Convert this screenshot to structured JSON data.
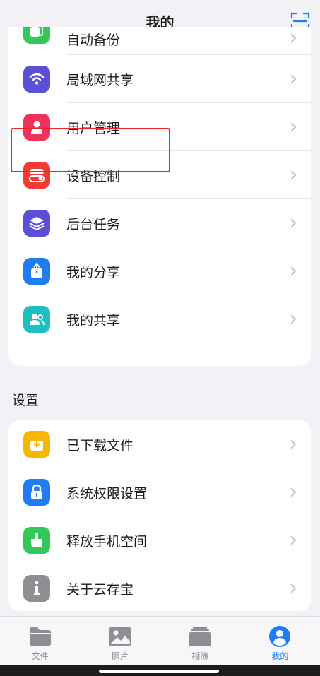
{
  "header": {
    "title": "我的"
  },
  "colors": {
    "accent": "#1e7df2",
    "highlight": "#e8262a"
  },
  "main_list": [
    {
      "label": "自动备份",
      "icon": "backup-icon",
      "color": "#34c759"
    },
    {
      "label": "局域网共享",
      "icon": "wifi-icon",
      "color": "#5b4fd6"
    },
    {
      "label": "用户管理",
      "icon": "user-icon",
      "color": "#f2315a"
    },
    {
      "label": "设备控制",
      "icon": "toggle-icon",
      "color": "#f23b32"
    },
    {
      "label": "后台任务",
      "icon": "layers-icon",
      "color": "#5b4fd6"
    },
    {
      "label": "我的分享",
      "icon": "share-icon",
      "color": "#1e7df2"
    },
    {
      "label": "我的共享",
      "icon": "users-icon",
      "color": "#1dbfbf"
    }
  ],
  "settings": {
    "title": "设置",
    "items": [
      {
        "label": "已下载文件",
        "icon": "download-icon",
        "color": "#f5b800"
      },
      {
        "label": "系统权限设置",
        "icon": "lock-icon",
        "color": "#1e7df2"
      },
      {
        "label": "释放手机空间",
        "icon": "broom-icon",
        "color": "#34c759"
      },
      {
        "label": "关于云存宝",
        "icon": "info-icon",
        "color": "#8e8e93"
      }
    ]
  },
  "tabs": [
    {
      "label": "文件",
      "icon": "folder-icon",
      "active": false
    },
    {
      "label": "照片",
      "icon": "photo-icon",
      "active": false
    },
    {
      "label": "相簿",
      "icon": "album-icon",
      "active": false
    },
    {
      "label": "我的",
      "icon": "profile-icon",
      "active": true
    }
  ]
}
